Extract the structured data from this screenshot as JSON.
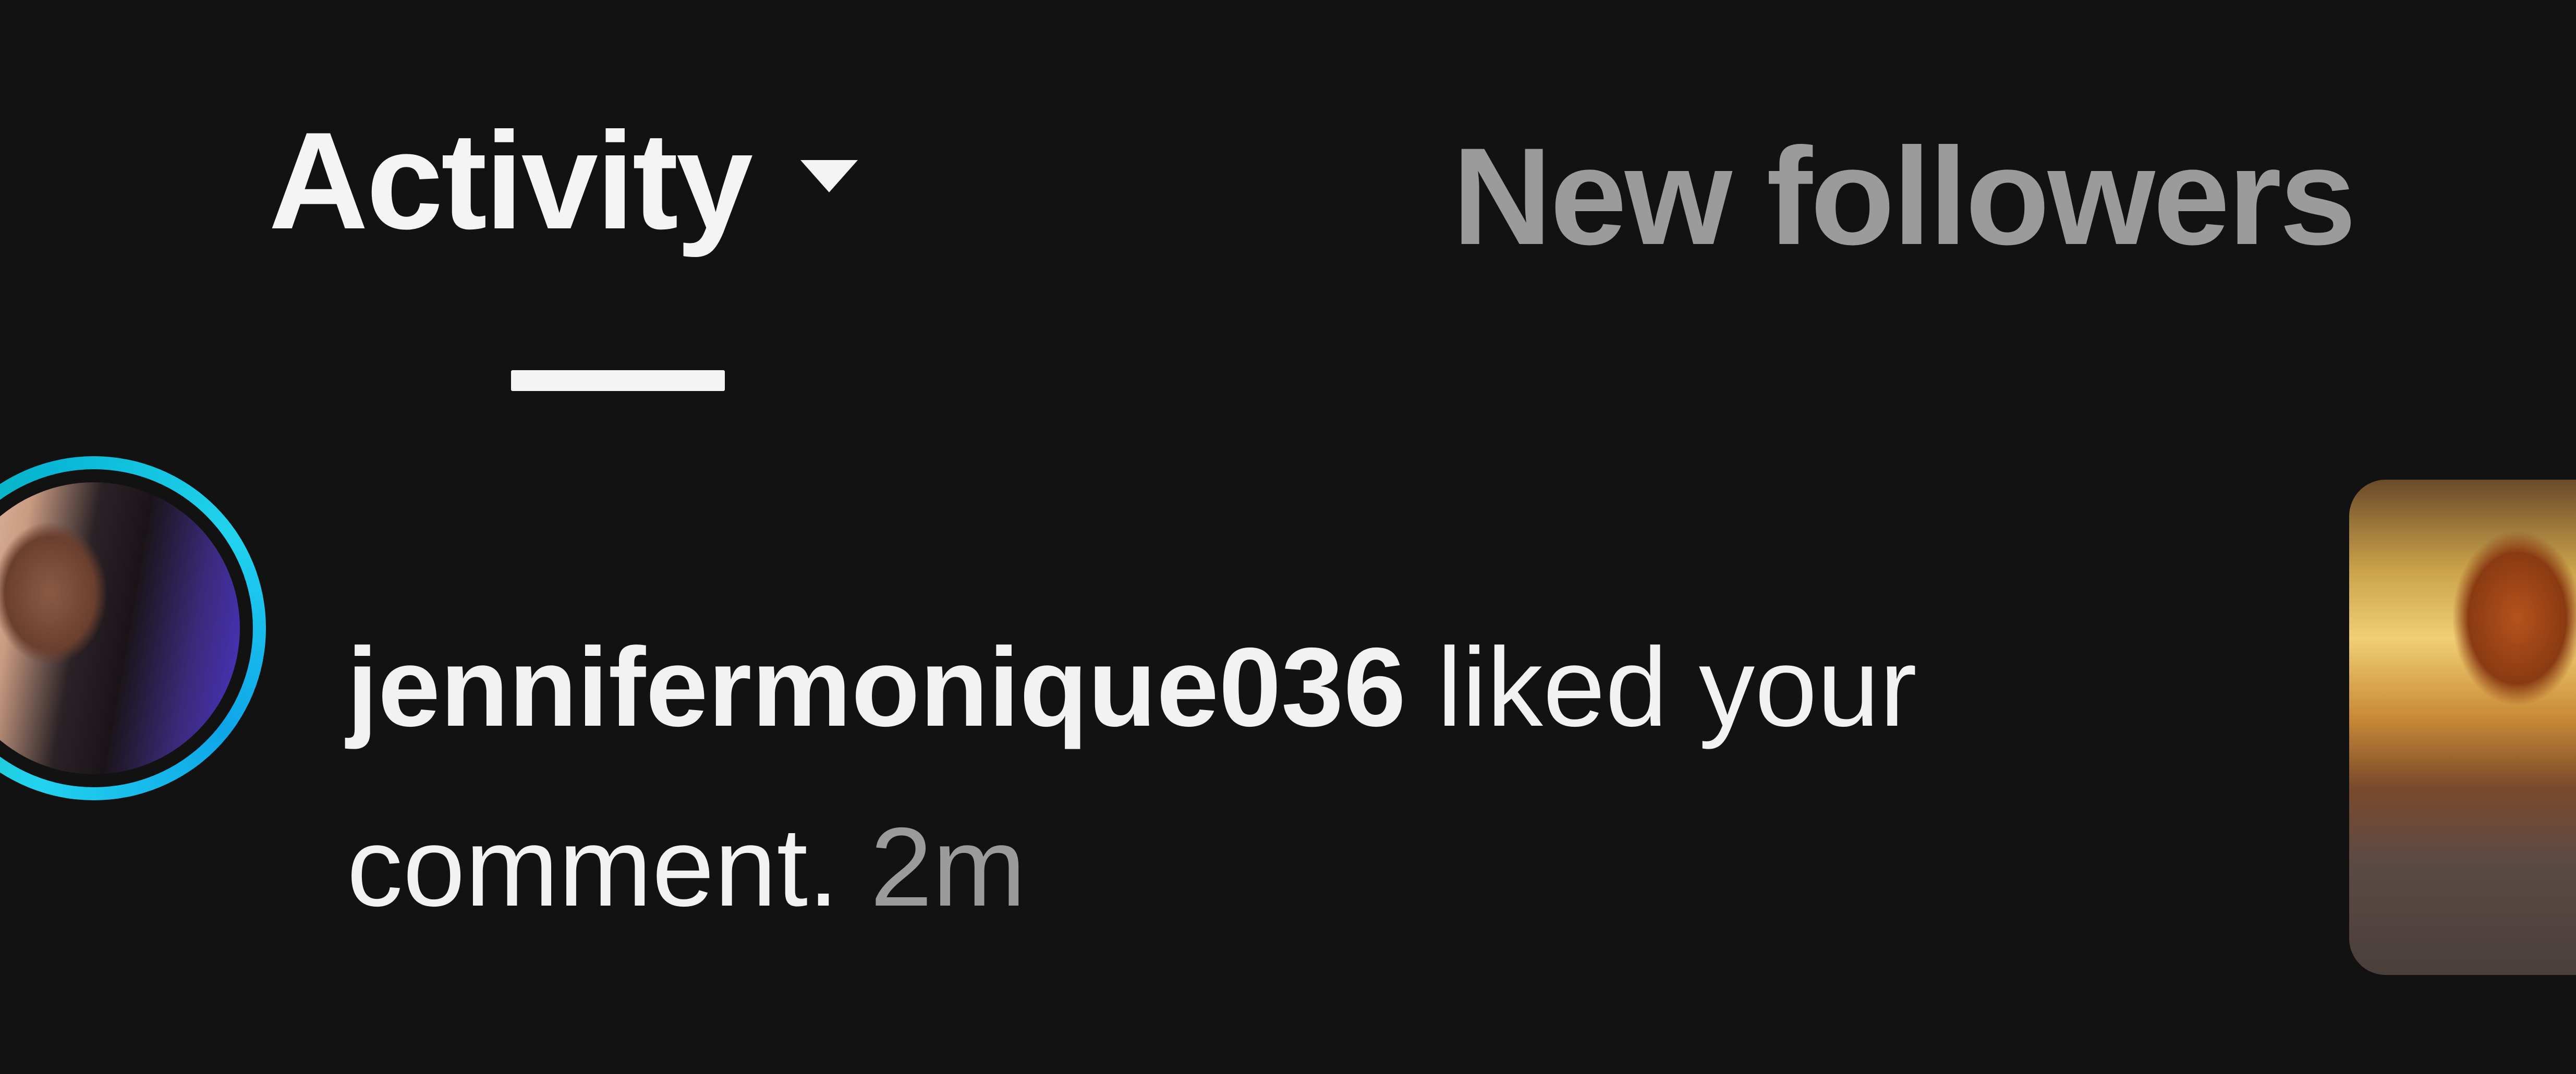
{
  "tabs": {
    "activity_label": "Activity",
    "new_followers_label": "New followers",
    "active": "activity"
  },
  "notification": {
    "username": "jennifermonique036",
    "message": "liked your comment.",
    "time": "2m",
    "avatar_ring_color": "#22d3ee"
  },
  "colors": {
    "background": "#121212",
    "primary_text": "#f2f2f2",
    "secondary_text": "#9b9b9b"
  }
}
